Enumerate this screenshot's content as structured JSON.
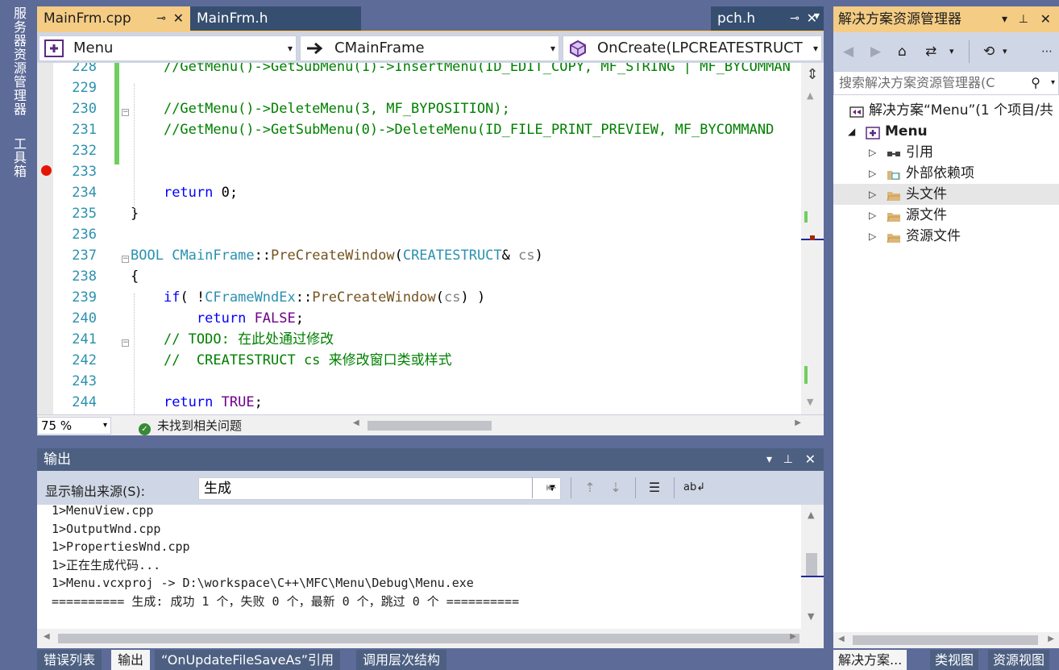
{
  "left_strip": {
    "server_explorer": "服务器资源管理器",
    "toolbox": "工具箱"
  },
  "editor_tabs": {
    "active": {
      "label": "MainFrm.cpp",
      "pin": "⊸",
      "close": "✕"
    },
    "inactive": {
      "label": "MainFrm.h"
    },
    "preview": {
      "label": "pch.h",
      "pin": "⊸",
      "close": "✕"
    },
    "overflow": "▾"
  },
  "nav": {
    "project": "Menu",
    "scope": "CMainFrame",
    "member": "OnCreate(LPCREATESTRUCT lp"
  },
  "code_lines": [
    {
      "n": "228",
      "html": "    <span class='c-cmt'>//GetMenu()->GetSubMenu(1)->InsertMenu(ID_EDIT_COPY, MF_STRING | MF_BYCOMMAN</span>"
    },
    {
      "n": "229",
      "html": ""
    },
    {
      "n": "230",
      "html": "    <span class='c-cmt'>//GetMenu()->DeleteMenu(3, MF_BYPOSITION);</span>"
    },
    {
      "n": "231",
      "html": "    <span class='c-cmt'>//GetMenu()->GetSubMenu(0)->DeleteMenu(ID_FILE_PRINT_PREVIEW, MF_BYCOMMAND</span>"
    },
    {
      "n": "232",
      "html": ""
    },
    {
      "n": "233",
      "html": ""
    },
    {
      "n": "234",
      "html": "    <span class='c-kw'>return</span> 0;"
    },
    {
      "n": "235",
      "html": "}"
    },
    {
      "n": "236",
      "html": ""
    },
    {
      "n": "237",
      "html": "<span class='c-type'>BOOL</span> <span class='c-type'>CMainFrame</span>::<span class='c-fn'>PreCreateWindow</span>(<span class='c-type'>CREATESTRUCT</span>&amp; <span class='c-par'>cs</span>)"
    },
    {
      "n": "238",
      "html": "{"
    },
    {
      "n": "239",
      "html": "    <span class='c-kw'>if</span>( !<span class='c-type'>CFrameWndEx</span>::<span class='c-fn'>PreCreateWindow</span>(<span class='c-par'>cs</span>) )"
    },
    {
      "n": "240",
      "html": "        <span class='c-kw'>return</span> <span class='c-mac'>FALSE</span>;"
    },
    {
      "n": "241",
      "html": "    <span class='c-cmt'>// TODO: 在此处通过修改</span>"
    },
    {
      "n": "242",
      "html": "    <span class='c-cmt'>//  CREATESTRUCT cs 来修改窗口类或样式</span>"
    },
    {
      "n": "243",
      "html": ""
    },
    {
      "n": "244",
      "html": "    <span class='c-kw'>return</span> <span class='c-mac'>TRUE</span>;"
    }
  ],
  "editor_status": {
    "zoom": "75 %",
    "issues": "未找到相关问题"
  },
  "output": {
    "title": "输出",
    "source_label": "显示输出来源(S):",
    "source_value": "生成",
    "lines": [
      "1>MenuView.cpp",
      "1>OutputWnd.cpp",
      "1>PropertiesWnd.cpp",
      "1>正在生成代码...",
      "1>Menu.vcxproj -> D:\\workspace\\C++\\MFC\\Menu\\Debug\\Menu.exe",
      "========== 生成: 成功 1 个，失败 0 个，最新 0 个，跳过 0 个 =========="
    ]
  },
  "bottom_tabs": [
    "错误列表",
    "输出",
    "“OnUpdateFileSaveAs”引用",
    "调用层次结构"
  ],
  "solution_explorer": {
    "title": "解决方案资源管理器",
    "search_placeholder": "搜索解决方案资源管理器(C",
    "tree": [
      {
        "label": "解决方案“Menu”(1 个项目/共",
        "level": 0,
        "expander": "",
        "icon": "solution-icon"
      },
      {
        "label": "Menu",
        "level": 1,
        "expander": "◢",
        "icon": "project-icon",
        "bold": true
      },
      {
        "label": "引用",
        "level": 2,
        "expander": "▷",
        "icon": "references-icon"
      },
      {
        "label": "外部依赖项",
        "level": 2,
        "expander": "▷",
        "icon": "external-deps-icon"
      },
      {
        "label": "头文件",
        "level": 2,
        "expander": "▷",
        "icon": "folder-icon",
        "selected": true
      },
      {
        "label": "源文件",
        "level": 2,
        "expander": "▷",
        "icon": "folder-icon"
      },
      {
        "label": "资源文件",
        "level": 2,
        "expander": "▷",
        "icon": "folder-icon"
      }
    ],
    "bottom_tabs": [
      "解决方案...",
      "类视图",
      "资源视图"
    ]
  }
}
